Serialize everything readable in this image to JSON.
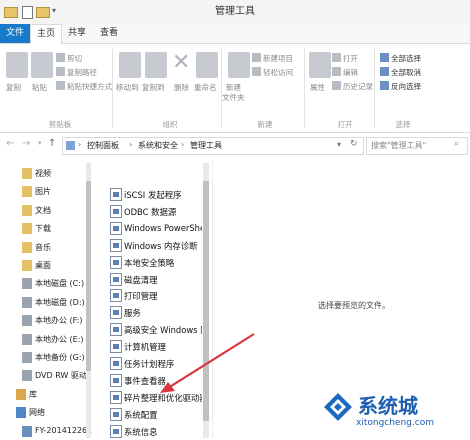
{
  "window": {
    "title": "管理工具"
  },
  "ribbon_tabs": [
    "文件",
    "主页",
    "共享",
    "查看"
  ],
  "ribbon": {
    "copy": "复制",
    "paste": "粘贴",
    "cut": "剪切",
    "copy_path": "复制路径",
    "paste_shortcut": "粘贴快捷方式",
    "group_clipboard": "剪贴板",
    "move_to": "移动到",
    "copy_to": "复制到",
    "delete": "删除",
    "rename": "重命名",
    "group_organize": "组织",
    "new_item": "新建项目",
    "easy_access": "轻松访问",
    "new_folder": "新建\n文件夹",
    "new_folder_l1": "新建",
    "new_folder_l2": "文件夹",
    "group_new": "新建",
    "properties": "属性",
    "open": "打开",
    "edit": "编辑",
    "history": "历史记录",
    "group_open": "打开",
    "select_all": "全部选择",
    "select_none": "全部取消",
    "invert": "反向选择",
    "group_select": "选择"
  },
  "address": {
    "crumbs": [
      "控制面板",
      "系统和安全",
      "管理工具"
    ],
    "sep": "›"
  },
  "search": {
    "placeholder": "搜索\"管理工具\""
  },
  "nav": {
    "items": [
      {
        "label": "视频",
        "icon": "video-folder-icon"
      },
      {
        "label": "图片",
        "icon": "picture-folder-icon"
      },
      {
        "label": "文档",
        "icon": "document-folder-icon"
      },
      {
        "label": "下载",
        "icon": "download-folder-icon"
      },
      {
        "label": "音乐",
        "icon": "music-folder-icon"
      },
      {
        "label": "桌面",
        "icon": "desktop-folder-icon"
      },
      {
        "label": "本地磁盘 (C:)",
        "icon": "drive-icon"
      },
      {
        "label": "本地磁盘 (D:)",
        "icon": "drive-icon"
      },
      {
        "label": "本地办公 (F:)",
        "icon": "drive-icon"
      },
      {
        "label": "本地办公 (E:)",
        "icon": "drive-icon"
      },
      {
        "label": "本地备份 (G:)",
        "icon": "drive-icon"
      },
      {
        "label": "DVD RW 驱动",
        "icon": "dvd-drive-icon"
      },
      {
        "label": "库",
        "icon": "library-icon"
      },
      {
        "label": "网络",
        "icon": "network-icon"
      },
      {
        "label": "FY-201412261",
        "icon": "computer-icon"
      }
    ]
  },
  "files": [
    "iSCSI 发起程序",
    "ODBC 数据源",
    "Windows PowerShell IS",
    "Windows 内存诊断",
    "本地安全策略",
    "磁盘清理",
    "打印管理",
    "服务",
    "高级安全 Windows 防火",
    "计算机管理",
    "任务计划程序",
    "事件查看器",
    "碎片整理和优化驱动器",
    "系统配置",
    "系统信息"
  ],
  "preview": {
    "empty_text": "选择要预览的文件。"
  },
  "watermark": {
    "brand": "系统城",
    "url": "xitongcheng.com"
  },
  "colors": {
    "file_tab": "#1979ca",
    "arrow": "#d9363e",
    "logo_blue": "#1d6ac1"
  }
}
